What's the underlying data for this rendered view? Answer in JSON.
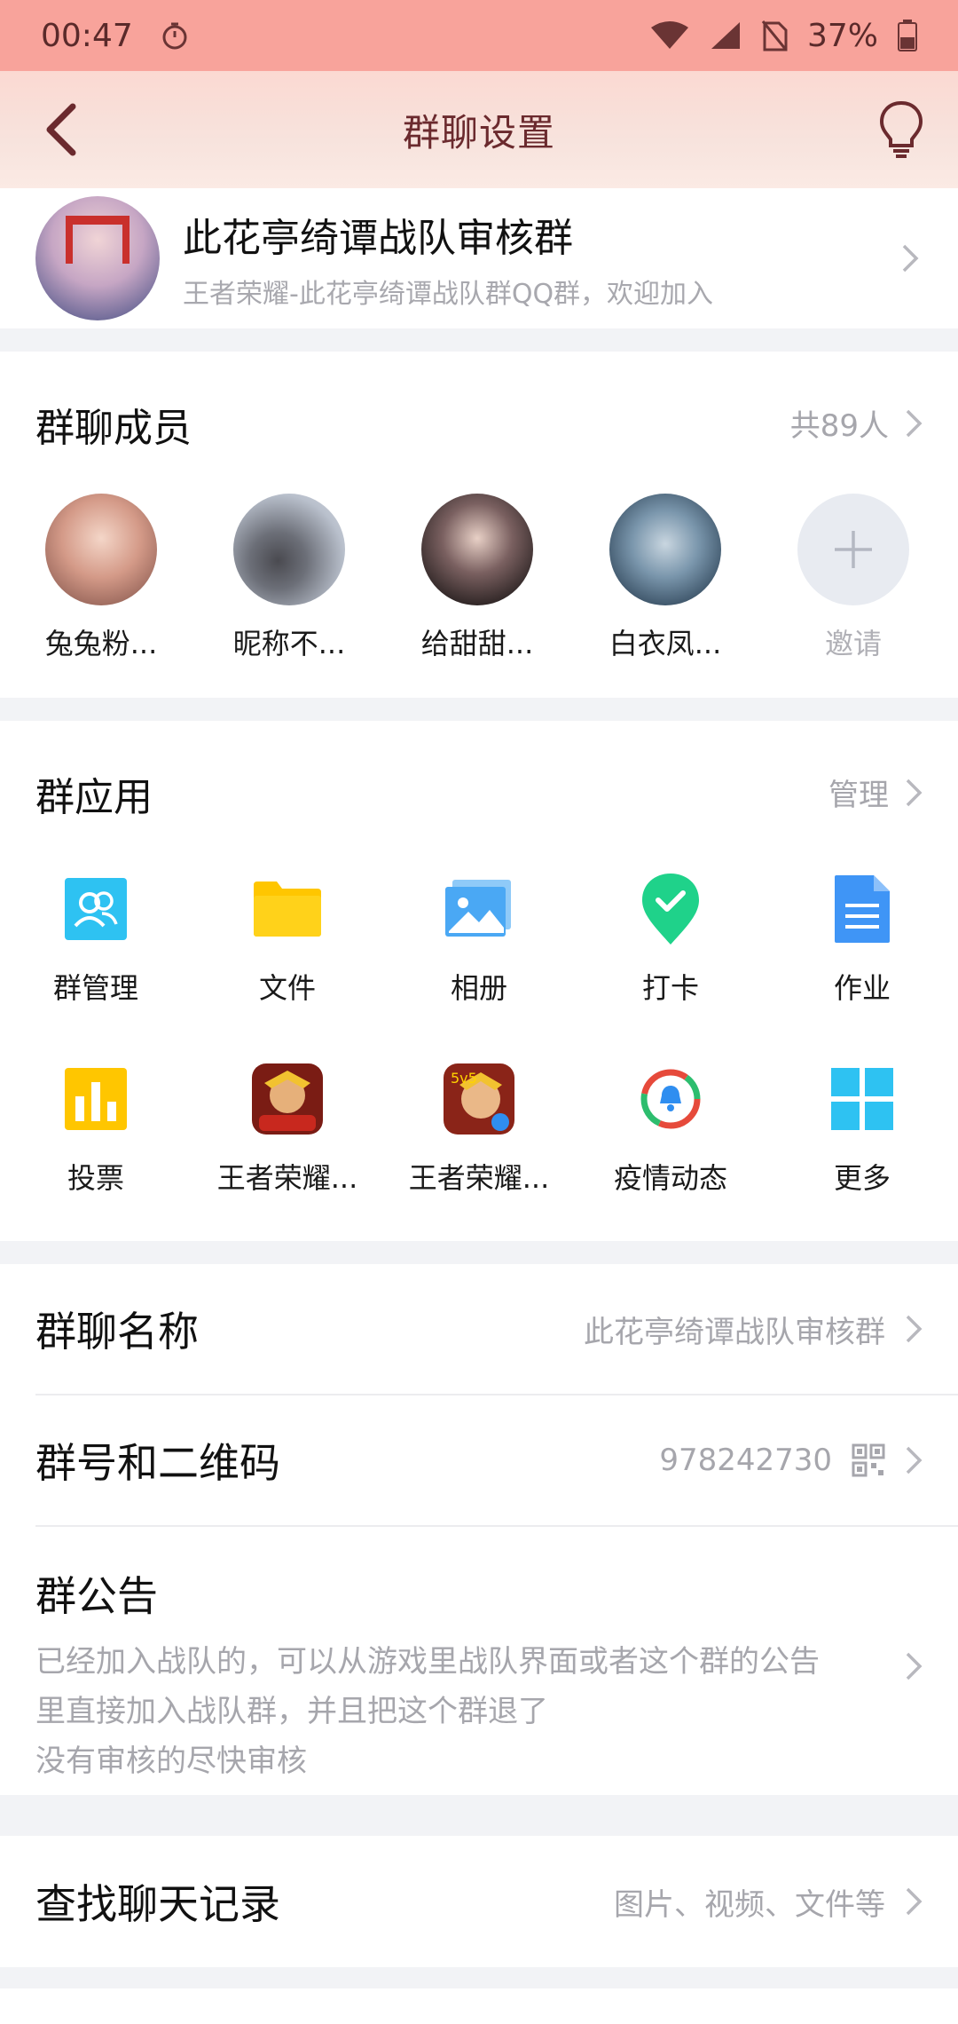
{
  "status_bar": {
    "time": "00:47",
    "battery": "37%"
  },
  "nav": {
    "title": "群聊设置"
  },
  "group": {
    "name": "此花亭绮谭战队审核群",
    "description": "王者荣耀-此花亭绮谭战队群QQ群，欢迎加入"
  },
  "members": {
    "title": "群聊成员",
    "count": "共89人",
    "list": [
      {
        "name": "兔兔粉..."
      },
      {
        "name": "昵称不..."
      },
      {
        "name": "给甜甜..."
      },
      {
        "name": "白衣凤..."
      }
    ],
    "invite_label": "邀请"
  },
  "apps": {
    "title": "群应用",
    "manage_label": "管理",
    "items": [
      {
        "label": "群管理",
        "icon": "group-manage-icon",
        "color": "#2ec2f2"
      },
      {
        "label": "文件",
        "icon": "folder-icon",
        "color": "#ffc600"
      },
      {
        "label": "相册",
        "icon": "photo-album-icon",
        "color": "#4aa8f4"
      },
      {
        "label": "打卡",
        "icon": "check-in-icon",
        "color": "#1fd28a"
      },
      {
        "label": "作业",
        "icon": "homework-icon",
        "color": "#3f95f6"
      },
      {
        "label": "投票",
        "icon": "vote-icon",
        "color": "#ffc600"
      },
      {
        "label": "王者荣耀...",
        "icon": "game-icon",
        "color": "#c8281e"
      },
      {
        "label": "王者荣耀...",
        "icon": "game-icon",
        "color": "#c8281e"
      },
      {
        "label": "疫情动态",
        "icon": "epidemic-icon",
        "color": "#e64a3b"
      },
      {
        "label": "更多",
        "icon": "more-grid-icon",
        "color": "#2ec2f2"
      }
    ]
  },
  "settings": {
    "name_label": "群聊名称",
    "name_value": "此花亭绮谭战队审核群",
    "number_label": "群号和二维码",
    "number_value": "978242730",
    "notice_label": "群公告",
    "notice_line1": "已经加入战队的，可以从游戏里战队界面或者这个群的公告",
    "notice_line2": "里直接加入战队群，并且把这个群退了",
    "notice_line3": "没有审核的尽快审核"
  },
  "search": {
    "label": "查找聊天记录",
    "hint": "图片、视频、文件等"
  }
}
